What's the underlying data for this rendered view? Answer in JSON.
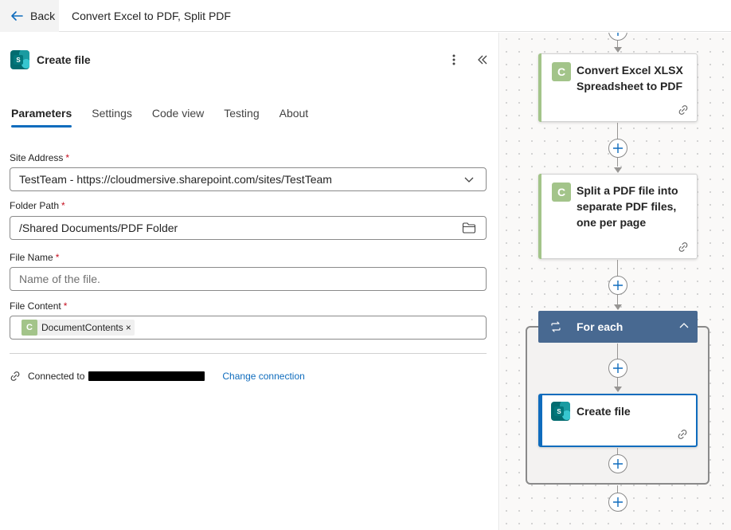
{
  "topbar": {
    "back_label": "Back",
    "flow_title": "Convert Excel to PDF, Split PDF"
  },
  "panel": {
    "title": "Create file",
    "icon": "sharepoint-icon",
    "tabs": [
      {
        "label": "Parameters",
        "active": true
      },
      {
        "label": "Settings"
      },
      {
        "label": "Code view"
      },
      {
        "label": "Testing"
      },
      {
        "label": "About"
      }
    ],
    "fields": {
      "site_address": {
        "label": "Site Address",
        "required": "*",
        "value": "TestTeam - https://cloudmersive.sharepoint.com/sites/TestTeam"
      },
      "folder_path": {
        "label": "Folder Path",
        "required": "*",
        "value": "/Shared Documents/PDF Folder"
      },
      "file_name": {
        "label": "File Name",
        "required": "*",
        "placeholder": "Name of the file."
      },
      "file_content": {
        "label": "File Content",
        "required": "*",
        "token_icon_letter": "C",
        "token_label": "DocumentContents",
        "token_remove": "×"
      }
    },
    "connection": {
      "label": "Connected to",
      "change_label": "Change connection"
    }
  },
  "canvas": {
    "cards": {
      "convert": {
        "icon_letter": "C",
        "title": "Convert Excel XLSX Spreadsheet to PDF"
      },
      "split": {
        "icon_letter": "C",
        "title": "Split a PDF file into separate PDF files, one per page"
      },
      "for_each": {
        "title": "For each"
      },
      "create_file": {
        "title": "Create file"
      }
    }
  },
  "colors": {
    "accent": "#0f6cbd",
    "cloudmersive": "#a3c48a",
    "foreach": "#486991",
    "sharepoint": "#036c70",
    "required": "#c50f1f"
  }
}
